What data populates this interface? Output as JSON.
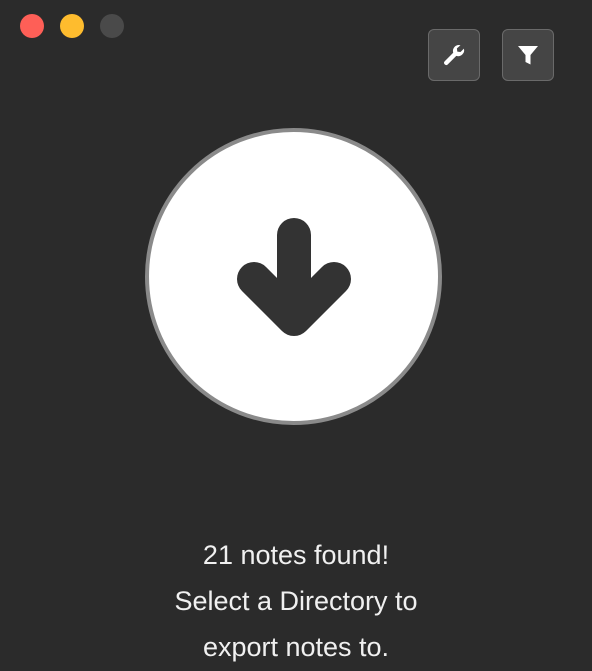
{
  "window": {
    "traffic_lights": [
      {
        "name": "close",
        "color": "#fe5f57"
      },
      {
        "name": "minimize",
        "color": "#febc2e"
      },
      {
        "name": "zoom",
        "color": "#4a4a4a"
      }
    ]
  },
  "toolbar": {
    "settings_icon": "wrench-icon",
    "filter_icon": "filter-icon"
  },
  "drop_target": {
    "icon": "arrow-down-icon",
    "icon_color": "#333333",
    "background": "#ffffff",
    "ring_color": "#8a8a8a"
  },
  "message": {
    "line1": "21 notes found!",
    "line2": "Select a Directory to",
    "line3": "export notes to."
  }
}
